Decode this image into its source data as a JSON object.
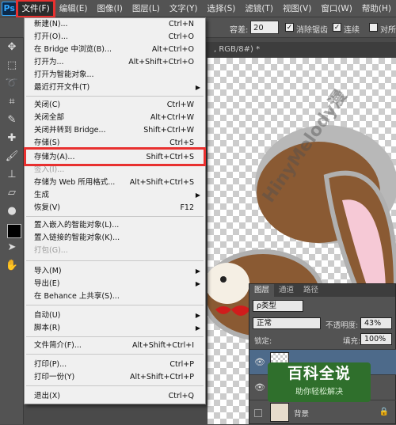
{
  "menubar": {
    "logo": "Ps",
    "items": [
      "文件(F)",
      "编辑(E)",
      "图像(I)",
      "图层(L)",
      "文字(Y)",
      "选择(S)",
      "滤镜(T)",
      "视图(V)",
      "窗口(W)",
      "帮助(H)"
    ]
  },
  "options_bar": {
    "tolerance_label": "容差:",
    "tolerance_value": "20",
    "antialias_label": "消除锯齿",
    "contiguous_label": "连续",
    "sample_all_label": "对所"
  },
  "document_tab": {
    "title": ", RGB/8#) *"
  },
  "file_menu": {
    "items": [
      {
        "label": "新建(N)...",
        "shortcut": "Ctrl+N",
        "disabled": false,
        "submenu": false
      },
      {
        "label": "打开(O)...",
        "shortcut": "Ctrl+O",
        "disabled": false,
        "submenu": false
      },
      {
        "label": "在 Bridge 中浏览(B)...",
        "shortcut": "Alt+Ctrl+O",
        "disabled": false,
        "submenu": false
      },
      {
        "label": "打开为...",
        "shortcut": "Alt+Shift+Ctrl+O",
        "disabled": false,
        "submenu": false
      },
      {
        "label": "打开为智能对象...",
        "shortcut": "",
        "disabled": false,
        "submenu": false
      },
      {
        "label": "最近打开文件(T)",
        "shortcut": "",
        "disabled": false,
        "submenu": true
      },
      {
        "label": "关闭(C)",
        "shortcut": "Ctrl+W",
        "disabled": false,
        "submenu": false
      },
      {
        "label": "关闭全部",
        "shortcut": "Alt+Ctrl+W",
        "disabled": false,
        "submenu": false
      },
      {
        "label": "关闭并转到 Bridge...",
        "shortcut": "Shift+Ctrl+W",
        "disabled": false,
        "submenu": false
      },
      {
        "label": "存储(S)",
        "shortcut": "Ctrl+S",
        "disabled": false,
        "submenu": false
      },
      {
        "label": "存储为(A)...",
        "shortcut": "Shift+Ctrl+S",
        "disabled": false,
        "submenu": false
      },
      {
        "label": "签入(I)...",
        "shortcut": "",
        "disabled": true,
        "submenu": false
      },
      {
        "label": "存储为 Web 所用格式...",
        "shortcut": "Alt+Shift+Ctrl+S",
        "disabled": false,
        "submenu": false
      },
      {
        "label": "生成",
        "shortcut": "",
        "disabled": false,
        "submenu": true
      },
      {
        "label": "恢复(V)",
        "shortcut": "F12",
        "disabled": false,
        "submenu": false
      },
      {
        "label": "置入嵌入的智能对象(L)...",
        "shortcut": "",
        "disabled": false,
        "submenu": false
      },
      {
        "label": "置入链接的智能对象(K)...",
        "shortcut": "",
        "disabled": false,
        "submenu": false
      },
      {
        "label": "打包(G)...",
        "shortcut": "",
        "disabled": true,
        "submenu": false
      },
      {
        "label": "导入(M)",
        "shortcut": "",
        "disabled": false,
        "submenu": true
      },
      {
        "label": "导出(E)",
        "shortcut": "",
        "disabled": false,
        "submenu": true
      },
      {
        "label": "在 Behance 上共享(S)...",
        "shortcut": "",
        "disabled": false,
        "submenu": false
      },
      {
        "label": "自动(U)",
        "shortcut": "",
        "disabled": false,
        "submenu": true
      },
      {
        "label": "脚本(R)",
        "shortcut": "",
        "disabled": false,
        "submenu": true
      },
      {
        "label": "文件简介(F)...",
        "shortcut": "Alt+Shift+Ctrl+I",
        "disabled": false,
        "submenu": false
      },
      {
        "label": "打印(P)...",
        "shortcut": "Ctrl+P",
        "disabled": false,
        "submenu": false
      },
      {
        "label": "打印一份(Y)",
        "shortcut": "Alt+Shift+Ctrl+P",
        "disabled": false,
        "submenu": false
      },
      {
        "label": "退出(X)",
        "shortcut": "Ctrl+Q",
        "disabled": false,
        "submenu": false
      }
    ]
  },
  "layers_panel": {
    "tabs": [
      "图层",
      "通道",
      "路径"
    ],
    "filter_label": "ρ类型",
    "blend_mode": "正常",
    "opacity_label": "不透明度:",
    "opacity_value": "43%",
    "lock_label": "锁定:",
    "fill_label": "填充:",
    "fill_value": "100%",
    "layers": [
      "",
      "",
      "背景"
    ]
  },
  "watermark": {
    "canvas_text": "HinyMelody漫",
    "baike_title": "百科全说",
    "baike_subtitle": "助你轻松解决"
  },
  "colors": {
    "highlight": "#e8302f",
    "menu_bg": "#f0f0f0",
    "ui_dark": "#535353"
  }
}
